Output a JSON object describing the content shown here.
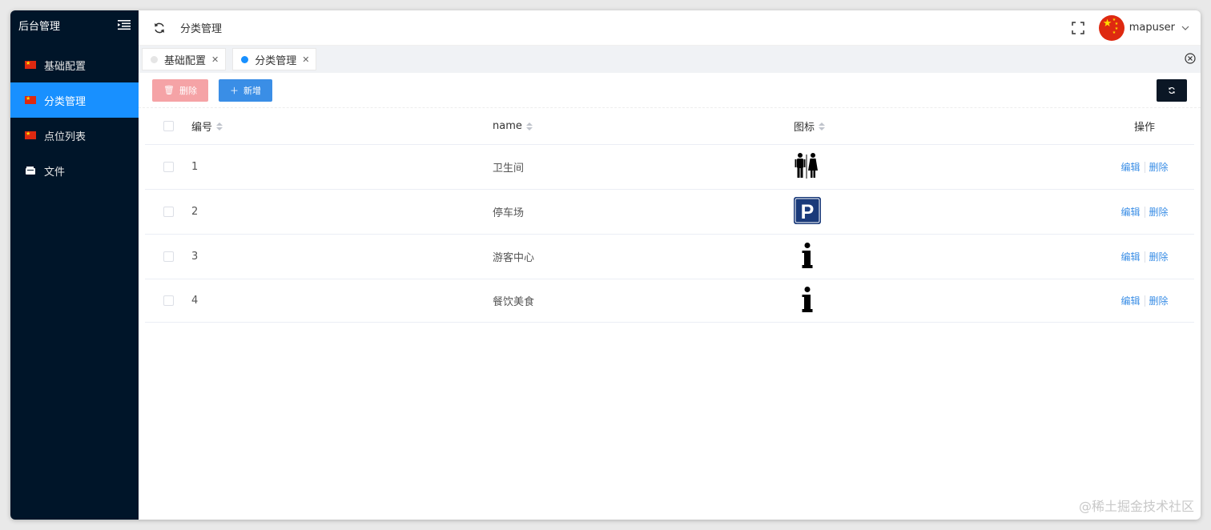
{
  "sidebar": {
    "title": "后台管理",
    "items": [
      {
        "label": "基础配置",
        "icon": "cn-flag-icon",
        "active": false
      },
      {
        "label": "分类管理",
        "icon": "cn-flag-icon",
        "active": true
      },
      {
        "label": "点位列表",
        "icon": "cn-flag-icon",
        "active": false
      },
      {
        "label": "文件",
        "icon": "folder-icon",
        "active": false
      }
    ]
  },
  "header": {
    "breadcrumb": "分类管理",
    "username": "mapuser"
  },
  "tabs": [
    {
      "label": "基础配置",
      "active": false
    },
    {
      "label": "分类管理",
      "active": true
    }
  ],
  "toolbar": {
    "delete_label": "删除",
    "add_label": "新增"
  },
  "table": {
    "columns": [
      "编号",
      "name",
      "图标",
      "操作"
    ],
    "rows": [
      {
        "id": "1",
        "name": "卫生间",
        "icon": "restroom-icon"
      },
      {
        "id": "2",
        "name": "停车场",
        "icon": "parking-icon"
      },
      {
        "id": "3",
        "name": "游客中心",
        "icon": "info-icon"
      },
      {
        "id": "4",
        "name": "餐饮美食",
        "icon": "info-icon"
      }
    ],
    "edit_label": "编辑",
    "delete_label": "删除"
  },
  "watermark": "@稀土掘金技术社区",
  "colors": {
    "sidebar_bg": "#001529",
    "active": "#1890ff",
    "link": "#3a8ee6",
    "danger_disabled": "#f5a3a6"
  }
}
